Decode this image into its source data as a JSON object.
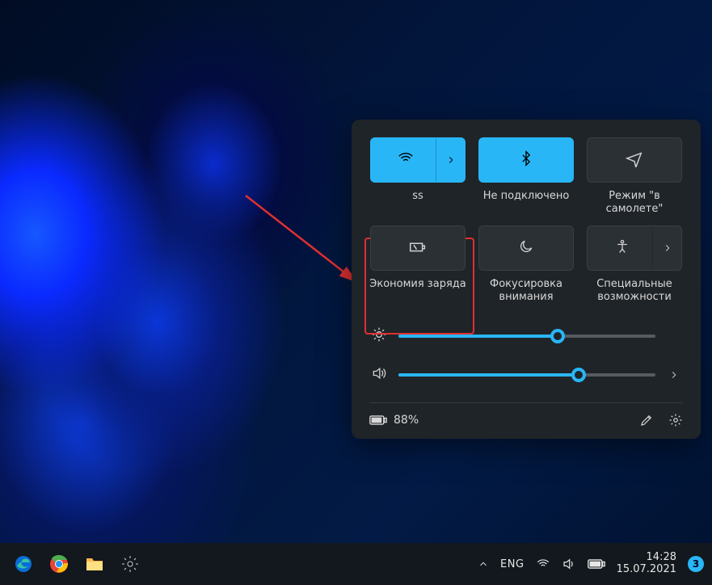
{
  "quick_settings": {
    "tiles": [
      {
        "id": "wifi",
        "label": "ss",
        "active": true
      },
      {
        "id": "bluetooth",
        "label": "Не подключено",
        "active": true
      },
      {
        "id": "airplane",
        "label": "Режим \"в самолете\"",
        "active": false
      },
      {
        "id": "battery-saver",
        "label": "Экономия заряда",
        "active": false
      },
      {
        "id": "focus",
        "label": "Фокусировка внимания",
        "active": false
      },
      {
        "id": "accessibility",
        "label": "Специальные возможности",
        "active": false
      }
    ],
    "brightness_percent": 62,
    "volume_percent": 70,
    "battery_text": "88%"
  },
  "taskbar": {
    "language": "ENG",
    "time": "14:28",
    "date": "15.07.2021",
    "notification_count": "3"
  },
  "colors": {
    "accent": "#29b6f6",
    "highlight": "#e03030"
  }
}
